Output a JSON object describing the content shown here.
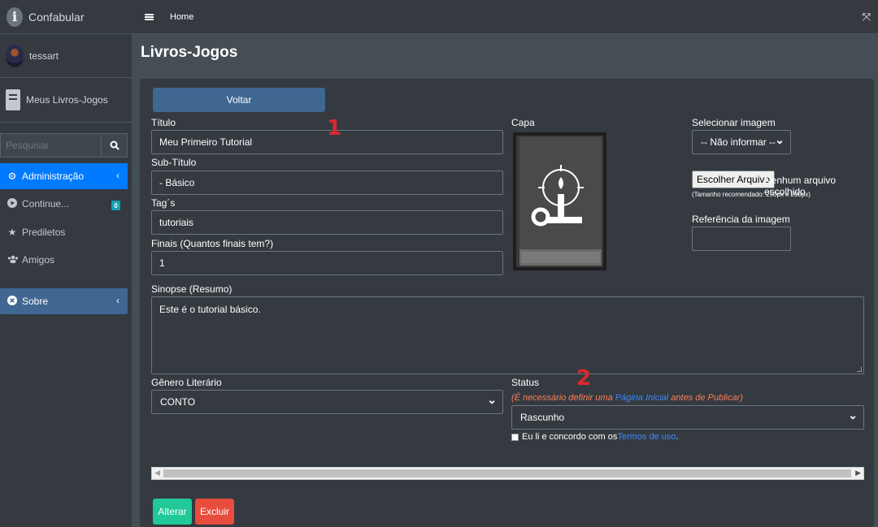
{
  "brand": {
    "name": "Confabular"
  },
  "user": {
    "name": "tessart"
  },
  "sidebar": {
    "my_books": "Meus Livros-Jogos",
    "search_placeholder": "Pesquisar",
    "items": [
      {
        "label": "Administração",
        "icon": "gear-icon"
      },
      {
        "label": "Continue...",
        "icon": "play-circle-icon",
        "badge": "0"
      },
      {
        "label": "Prediletos",
        "icon": "star-icon"
      },
      {
        "label": "Amigos",
        "icon": "users-icon"
      },
      {
        "label": "Sobre",
        "icon": "times-circle-icon"
      }
    ]
  },
  "topbar": {
    "home": "Home"
  },
  "page": {
    "title": "Livros-Jogos"
  },
  "form": {
    "back_button": "Voltar",
    "titulo": {
      "label": "Título",
      "value": "Meu Primeiro Tutorial"
    },
    "subtitulo": {
      "label": "Sub-Título",
      "value": "- Básico"
    },
    "tags": {
      "label": "Tag´s",
      "value": "tutoriais"
    },
    "finais": {
      "label": "Finais (Quantos finais tem?)",
      "value": "1"
    },
    "capa": {
      "label": "Capa"
    },
    "select_image": {
      "label": "Selecionar imagem",
      "value": "-- Não informar --"
    },
    "file": {
      "button": "Escolher Arquivo",
      "status": "Nenhum arquivo escolhido",
      "hint": "(Tamanho recomendado: 250px x 200px)"
    },
    "image_ref": {
      "label": "Referência da imagem",
      "value": ""
    },
    "sinopse": {
      "label": "Sinopse (Resumo)",
      "value": "Este é o tutorial básico."
    },
    "genero": {
      "label": "Gênero Literário",
      "value": "CONTO"
    },
    "status": {
      "label": "Status",
      "note_prefix": "(É necessário definir uma ",
      "note_link": "Página Inicial",
      "note_suffix": " antes de Publicar)",
      "value": "Rascunho"
    },
    "terms": {
      "prefix": "Eu li e concordo com os ",
      "link": "Termos de uso",
      "suffix": "."
    },
    "save_button": "Alterar",
    "delete_button": "Excluir"
  },
  "annotations": {
    "marker1": "1",
    "marker2": "2"
  },
  "colors": {
    "primary": "#007bff",
    "success": "#20c997",
    "danger": "#e74c3c",
    "warning_text": "#fd7e5a",
    "link": "#3d8bfd"
  }
}
